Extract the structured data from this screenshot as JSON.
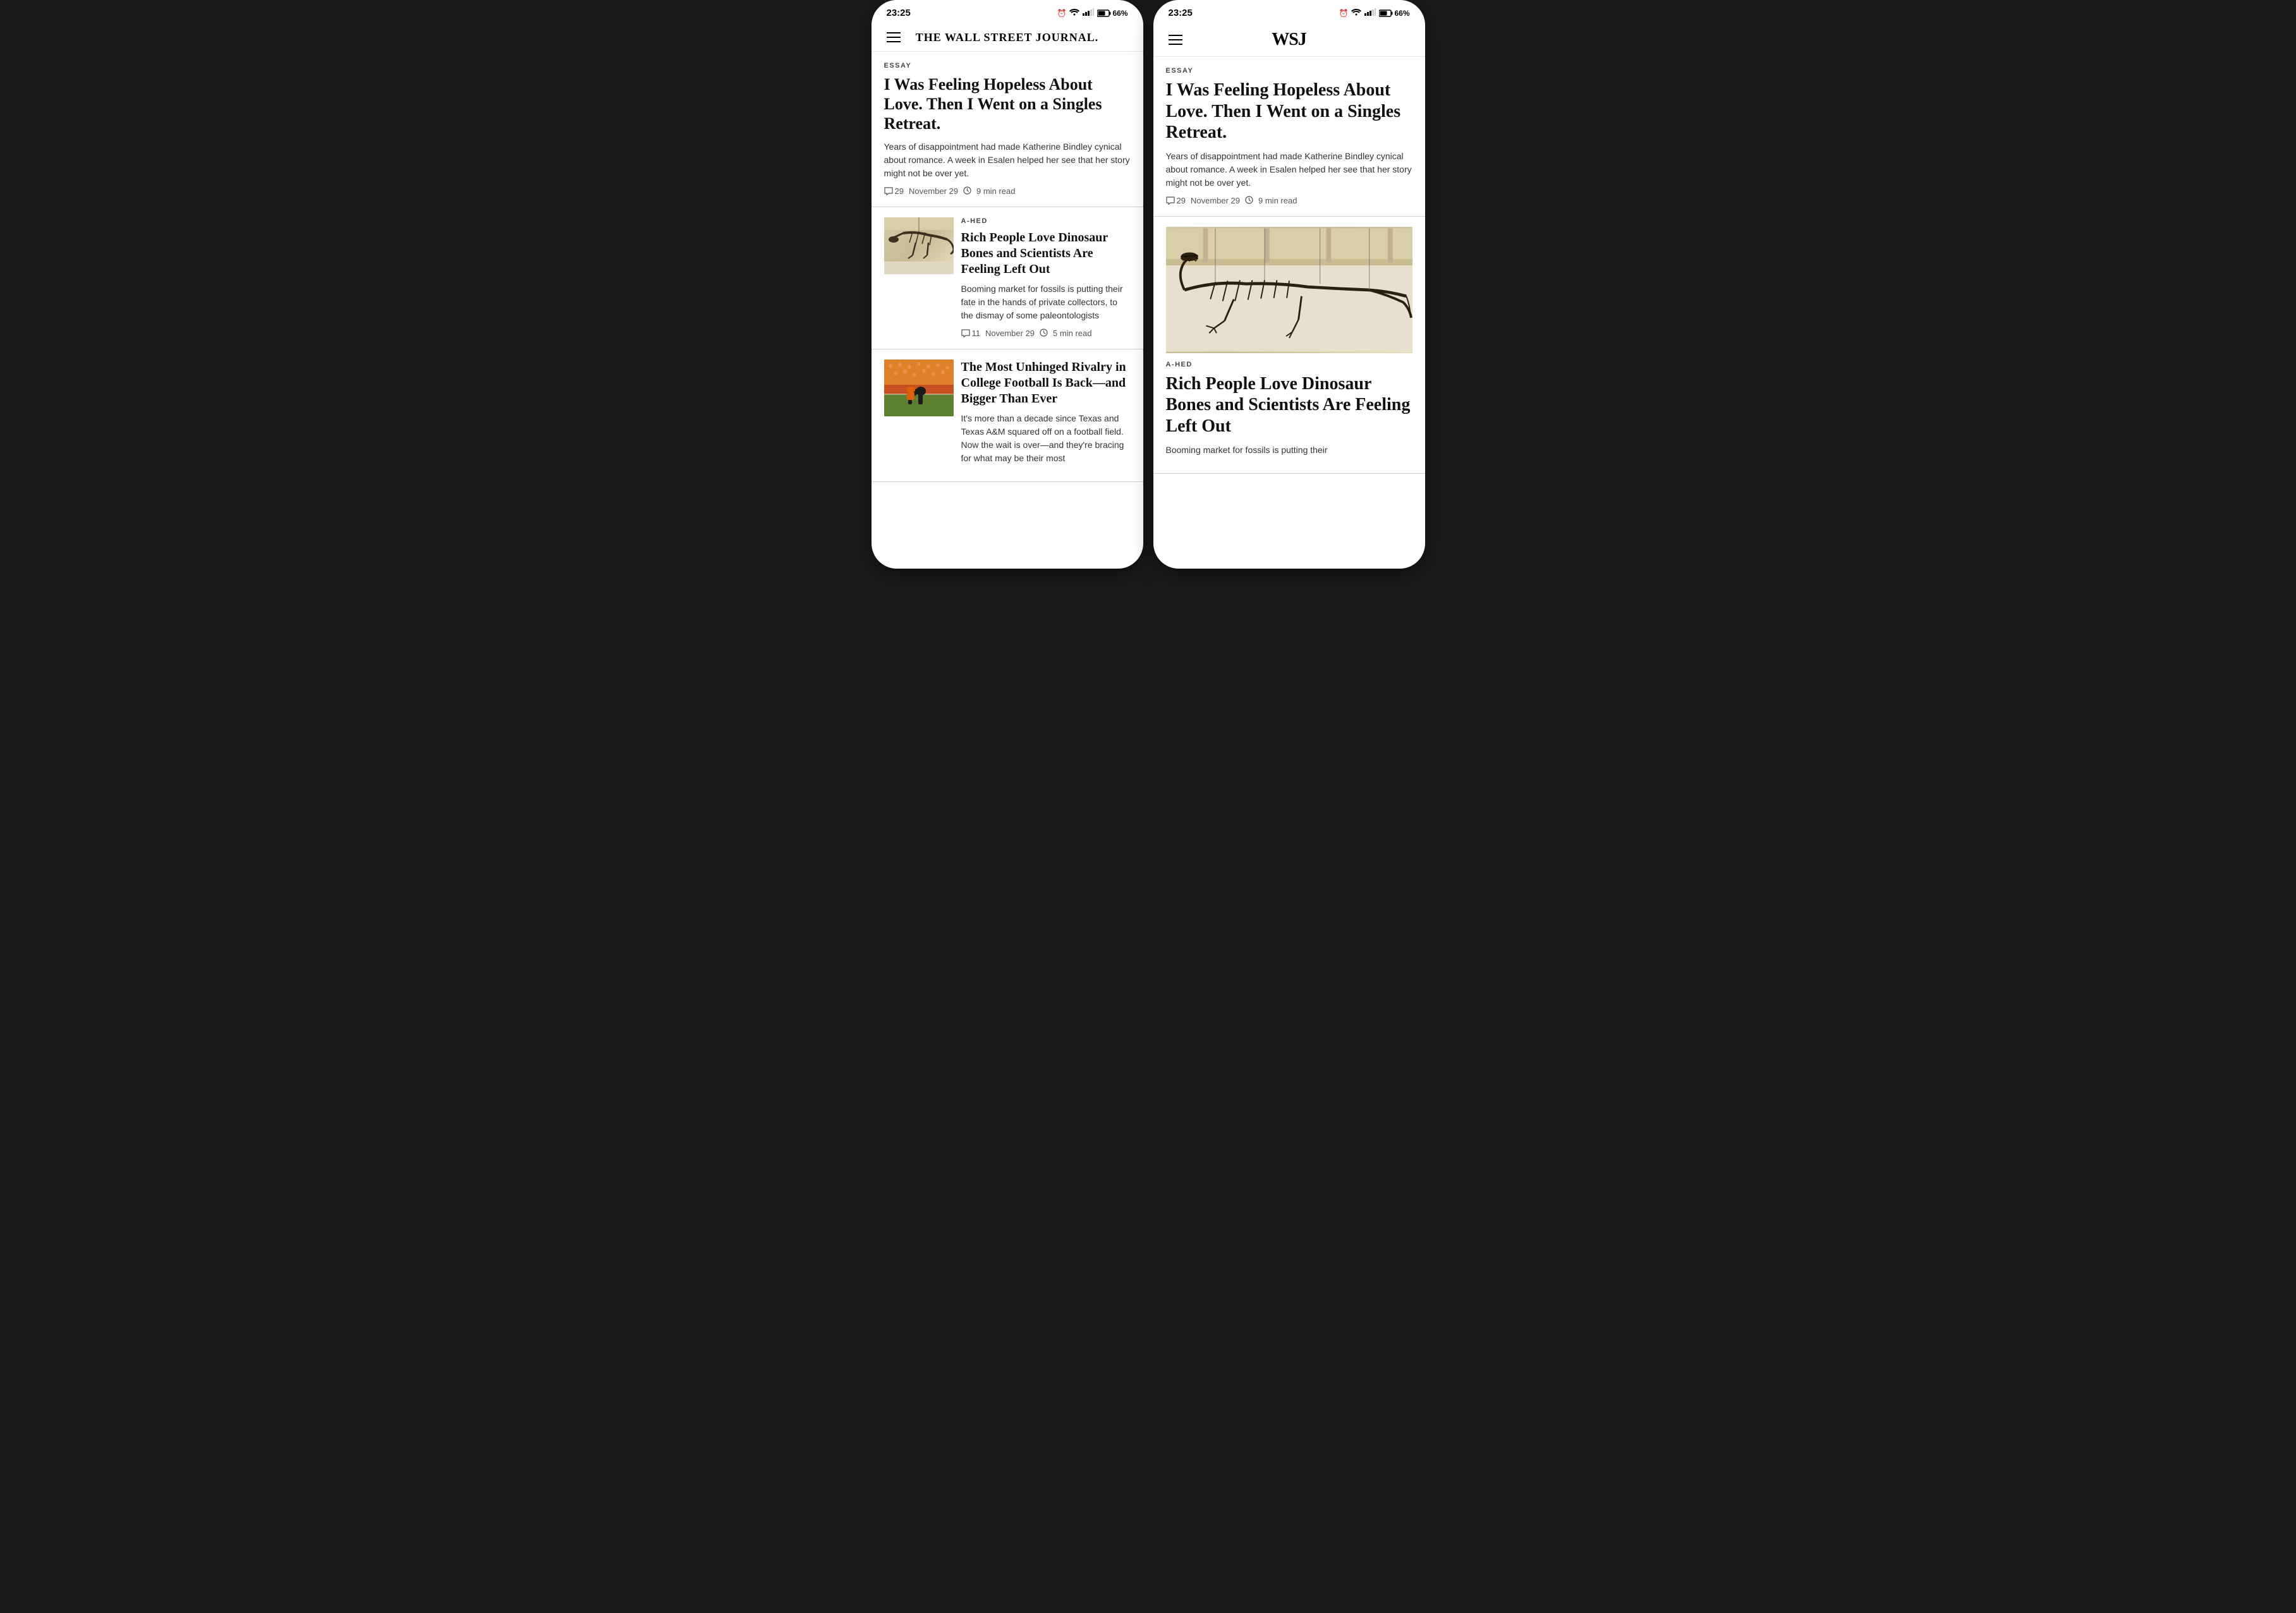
{
  "left_phone": {
    "status": {
      "time": "23:25",
      "battery": "66%",
      "icons": "⏰ 📶 📶 📶 🔋"
    },
    "nav": {
      "title": "THE WALL STREET JOURNAL."
    },
    "articles": [
      {
        "label": "ESSAY",
        "title": "I Was Feeling Hopeless About Love. Then I Went on a Singles Retreat.",
        "subtitle": "Years of disappointment had made Katherine Bindley cynical about romance. A week in Esalen helped her see that her story might not be over yet.",
        "comments": "29",
        "date": "November 29",
        "read_time": "9 min read",
        "has_image": false
      },
      {
        "label": "A-HED",
        "title": "Rich People Love Dinosaur Bones and Scientists Are Feeling Left Out",
        "subtitle": "Booming market for fossils is putting their fate in the hands of private collectors, to the dismay of some paleontologists",
        "comments": "11",
        "date": "November 29",
        "read_time": "5 min read",
        "has_image": true,
        "image_type": "dino"
      },
      {
        "label": "",
        "title": "The Most Unhinged Rivalry in College Football Is Back—and Bigger Than Ever",
        "subtitle": "It's more than a decade since Texas and Texas A&M squared off on a football field. Now the wait is over—and they're bracing for what may be their most",
        "comments": "",
        "date": "",
        "read_time": "",
        "has_image": true,
        "image_type": "football"
      }
    ]
  },
  "right_phone": {
    "status": {
      "time": "23:25",
      "battery": "66%"
    },
    "nav": {
      "title": "WSJ"
    },
    "articles": [
      {
        "label": "ESSAY",
        "title": "I Was Feeling Hopeless About Love. Then I Went on a Singles Retreat.",
        "subtitle": "Years of disappointment had made Katherine Bindley cynical about romance. A week in Esalen helped her see that her story might not be over yet.",
        "comments": "29",
        "date": "November 29",
        "read_time": "9 min read",
        "has_image": false
      },
      {
        "label": "A-HED",
        "title": "Rich People Love Dinosaur Bones and Scientists Are Feeling Left Out",
        "subtitle": "Booming market for fossils is putting their",
        "comments": "",
        "date": "",
        "read_time": "",
        "has_image": true,
        "image_type": "dino"
      }
    ]
  }
}
